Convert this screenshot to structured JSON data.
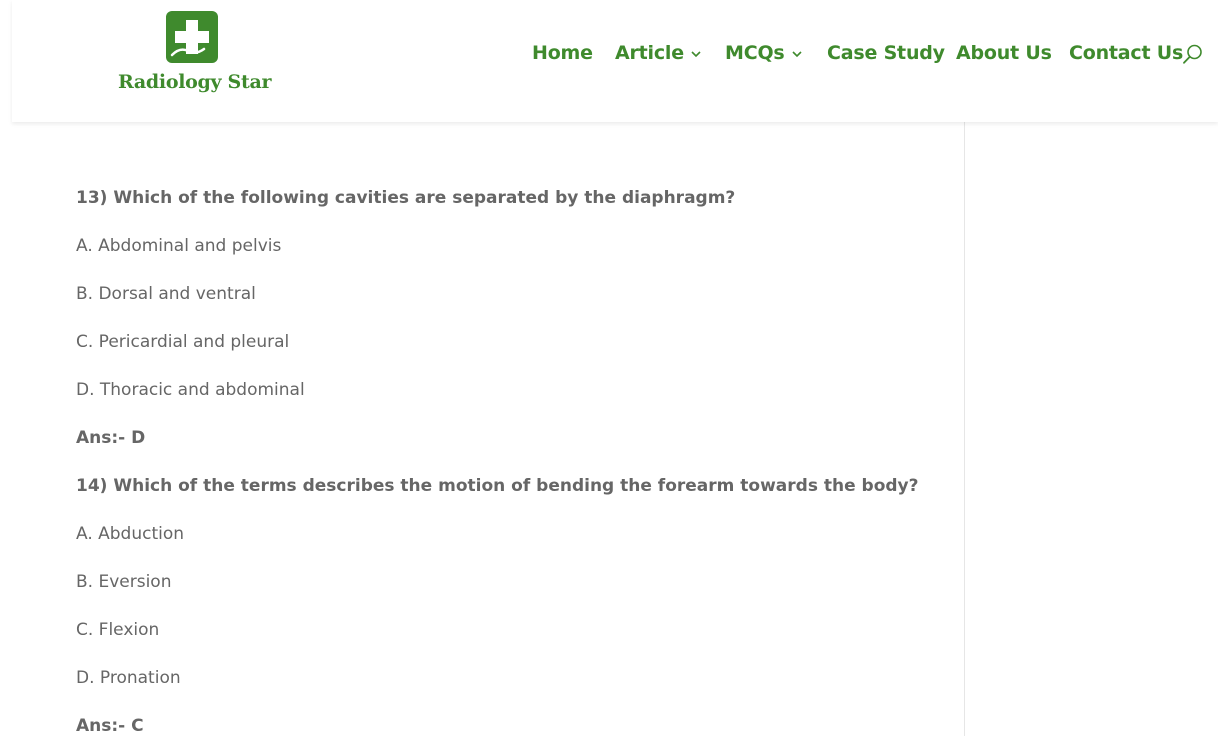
{
  "brand": {
    "name": "Radiology Star",
    "primary_color": "#3f8a2d",
    "logo_icon": "medical-cross-icon"
  },
  "nav": {
    "items": [
      {
        "label": "Home",
        "has_dropdown": false
      },
      {
        "label": "Article",
        "has_dropdown": true
      },
      {
        "label": "MCQs",
        "has_dropdown": true
      },
      {
        "label": "Case Study",
        "has_dropdown": false
      },
      {
        "label": "About Us",
        "has_dropdown": false
      },
      {
        "label": "Contact Us",
        "has_dropdown": false
      }
    ],
    "search_icon": "search-icon"
  },
  "content": {
    "questions": [
      {
        "question": "13) Which of the following cavities are separated by the diaphragm?",
        "options": [
          "A. Abdominal and pelvis",
          "B. Dorsal and ventral",
          "C. Pericardial and pleural",
          "D. Thoracic and abdominal"
        ],
        "answer": "Ans:- D"
      },
      {
        "question": "14) Which of the terms describes the motion of bending the forearm towards the body?",
        "options": [
          "A. Abduction",
          "B. Eversion",
          "C. Flexion",
          "D. Pronation"
        ],
        "answer": "Ans:- C"
      }
    ]
  }
}
